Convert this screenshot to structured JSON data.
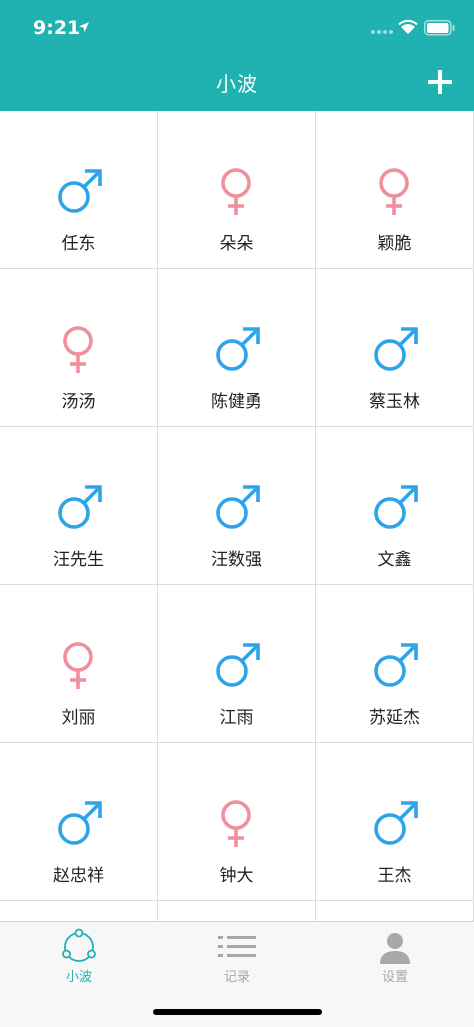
{
  "status_bar": {
    "time": "9:21"
  },
  "nav": {
    "title": "小波",
    "add_icon": "plus-icon"
  },
  "colors": {
    "accent": "#20b1b1",
    "male": "#2ea3e8",
    "female": "#f0909c",
    "tab_inactive": "#a8a8a8"
  },
  "contacts": [
    {
      "name": "任东",
      "gender": "male"
    },
    {
      "name": "朵朵",
      "gender": "female"
    },
    {
      "name": "颖脆",
      "gender": "female"
    },
    {
      "name": "汤汤",
      "gender": "female"
    },
    {
      "name": "陈健勇",
      "gender": "male"
    },
    {
      "name": "蔡玉林",
      "gender": "male"
    },
    {
      "name": "汪先生",
      "gender": "male"
    },
    {
      "name": "汪数强",
      "gender": "male"
    },
    {
      "name": "文鑫",
      "gender": "male"
    },
    {
      "name": "刘丽",
      "gender": "female"
    },
    {
      "name": "江雨",
      "gender": "male"
    },
    {
      "name": "苏延杰",
      "gender": "male"
    },
    {
      "name": "赵忠祥",
      "gender": "male"
    },
    {
      "name": "钟大",
      "gender": "female"
    },
    {
      "name": "王杰",
      "gender": "male"
    },
    {
      "name": "",
      "gender": ""
    },
    {
      "name": "",
      "gender": ""
    },
    {
      "name": "",
      "gender": ""
    }
  ],
  "tabs": [
    {
      "label": "小波",
      "icon": "share-network-icon",
      "active": true
    },
    {
      "label": "记录",
      "icon": "list-icon",
      "active": false
    },
    {
      "label": "设置",
      "icon": "person-icon",
      "active": false
    }
  ]
}
